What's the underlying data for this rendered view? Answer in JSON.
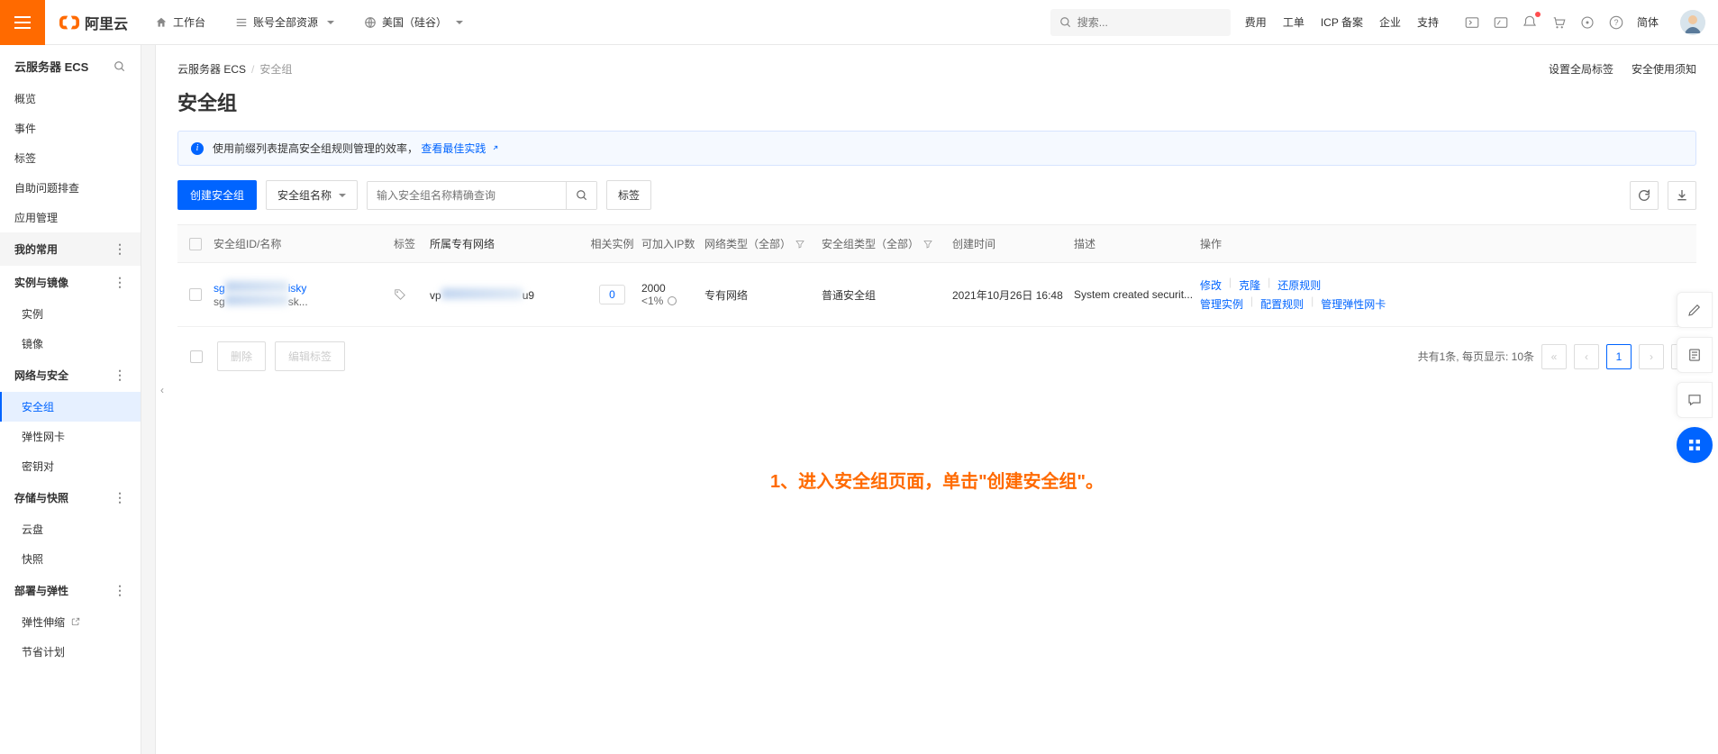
{
  "header": {
    "logo_text": "阿里云",
    "workbench": "工作台",
    "account_resources": "账号全部资源",
    "region": "美国（硅谷）",
    "search_placeholder": "搜索...",
    "right_links": [
      "费用",
      "工单",
      "ICP 备案",
      "企业",
      "支持"
    ],
    "simplified": "简体"
  },
  "sidebar": {
    "product_title": "云服务器 ECS",
    "items_top": [
      "概览",
      "事件",
      "标签",
      "自助问题排查",
      "应用管理"
    ],
    "my_common": "我的常用",
    "sections": [
      {
        "title": "实例与镜像",
        "items": [
          "实例",
          "镜像"
        ]
      },
      {
        "title": "网络与安全",
        "items": [
          "安全组",
          "弹性网卡",
          "密钥对"
        ],
        "active_index": 0
      },
      {
        "title": "存储与快照",
        "items": [
          "云盘",
          "快照"
        ]
      },
      {
        "title": "部署与弹性",
        "items": [
          "弹性伸缩",
          "节省计划"
        ],
        "external_first": true
      }
    ]
  },
  "breadcrumb": {
    "root": "云服务器 ECS",
    "current": "安全组"
  },
  "page_title": "安全组",
  "heading_links": [
    "设置全局标签",
    "安全使用须知"
  ],
  "info_banner": {
    "text": "使用前缀列表提高安全组规则管理的效率，",
    "link": "查看最佳实践"
  },
  "toolbar": {
    "create": "创建安全组",
    "name_filter": "安全组名称",
    "search_placeholder": "输入安全组名称精确查询",
    "tag_btn": "标签"
  },
  "table": {
    "headers": {
      "id": "安全组ID/名称",
      "tag": "标签",
      "vpc": "所属专有网络",
      "inst": "相关实例",
      "ip": "可加入IP数",
      "nettype": "网络类型（全部）",
      "sgtype": "安全组类型（全部）",
      "created": "创建时间",
      "desc": "描述",
      "ops": "操作"
    },
    "rows": [
      {
        "id_link": "sg",
        "id_link_suffix": "isky",
        "id_sub": "sg",
        "id_sub_suffix": "sk...",
        "vpc": "vp",
        "vpc_suffix": "u9",
        "inst": "0",
        "ip_count": "2000",
        "ip_pct": "<1%",
        "nettype": "专有网络",
        "sgtype": "普通安全组",
        "created": "2021年10月26日 16:48",
        "desc": "System created securit...",
        "ops_line1": [
          "修改",
          "克隆",
          "还原规则"
        ],
        "ops_line2": [
          "管理实例",
          "配置规则",
          "管理弹性网卡"
        ]
      }
    ]
  },
  "bottom": {
    "delete": "删除",
    "edit_tags": "编辑标签",
    "pagination_text": "共有1条, 每页显示:",
    "per_page": "10条",
    "current_page": "1"
  },
  "tutorial": "1、进入安全组页面，单击\"创建安全组\"。"
}
